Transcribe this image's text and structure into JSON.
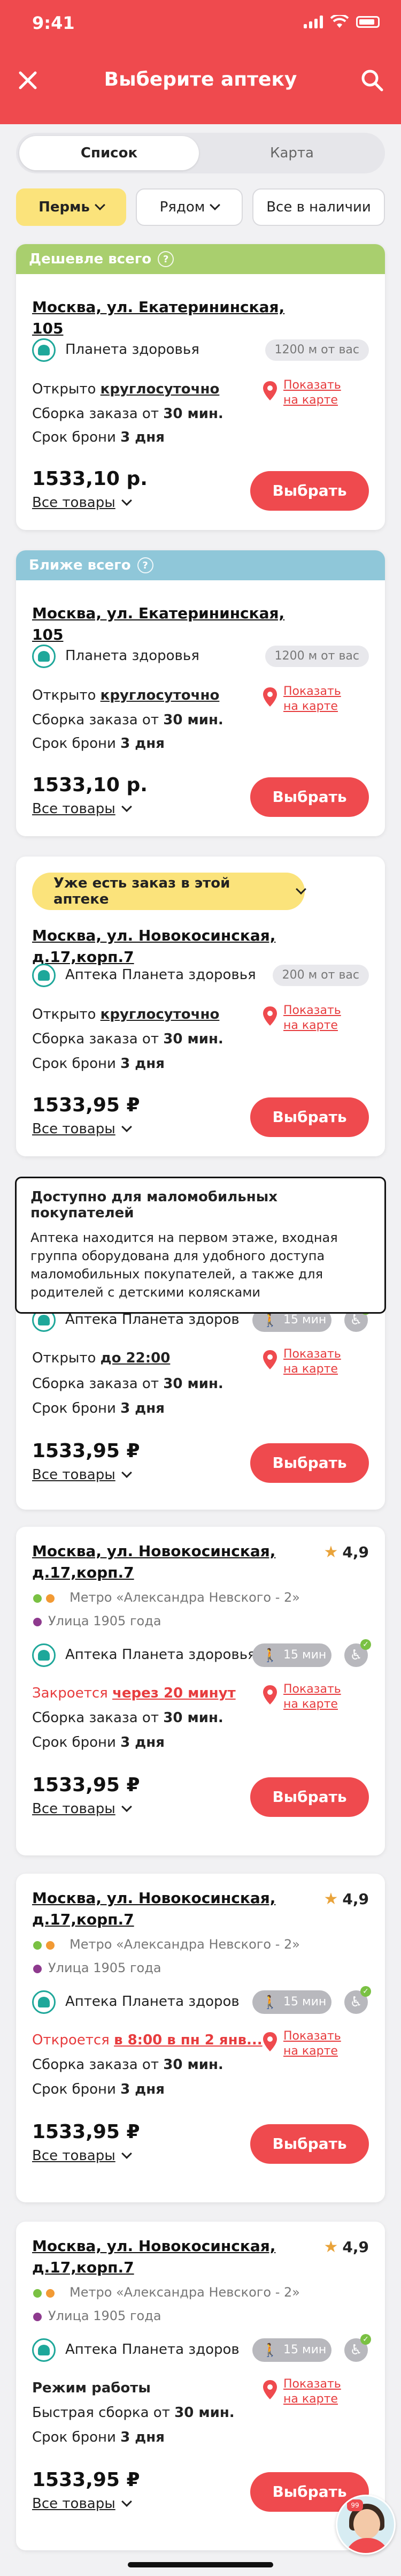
{
  "status": {
    "time": "9:41"
  },
  "header": {
    "title": "Выберите аптеку"
  },
  "tabs": {
    "list": "Список",
    "map": "Карта"
  },
  "filters": {
    "city": "Пермь",
    "near": "Рядом",
    "all": "Все в наличии"
  },
  "common": {
    "show_on_map_1": "Показать",
    "show_on_map_2": "на карте",
    "pickup_prefix": "Сборка заказа от ",
    "pickup_value": "30 мин.",
    "fast_pickup_prefix": "Быстрая сборка от ",
    "reserve_prefix": "Срок брони ",
    "reserve_value": "3 дня",
    "all_goods": "Все товары",
    "choose": "Выбрать",
    "walk_time": "15 мин",
    "metro": "Метро «Александра Невского - 2»",
    "street": "Улица 1905 года"
  },
  "cards": [
    {
      "badge": "Дешевле всего",
      "address": "Москва, ул. Екатерининская, 105",
      "pharmacy": "Планета здоровья",
      "distance": "1200 м от вас",
      "open_prefix": "Открыто ",
      "open_value": "круглосуточно",
      "price": "1533,10 р."
    },
    {
      "badge": "Ближе всего",
      "address": "Москва, ул. Екатерининская, 105",
      "pharmacy": "Планета здоровья",
      "distance": "1200 м от вас",
      "open_prefix": "Открыто ",
      "open_value": "круглосуточно",
      "price": "1533,10 р."
    },
    {
      "order_badge": "Уже есть заказ в этой аптеке",
      "address": "Москва, ул. Новокосинская, д.17,корп.7",
      "pharmacy": "Аптека Планета здоровья",
      "distance": "200 м от вас",
      "open_prefix": "Открыто ",
      "open_value": "круглосуточно",
      "price": "1533,95 ₽"
    },
    {
      "pharmacy": "Аптека Планета здоров",
      "open_prefix": "Открыто ",
      "open_value": "до 22:00",
      "price": "1533,95 ₽"
    },
    {
      "address_1": "Москва, ул. Новокосинская,",
      "address_2": "д.17,корп.7",
      "rating": "4,9",
      "pharmacy": "Аптека Планета здоровья",
      "status_prefix": "Закроется ",
      "status_value": "через 20 минут",
      "price": "1533,95 ₽"
    },
    {
      "address_1": "Москва, ул. Новокосинская,",
      "address_2": "д.17,корп.7",
      "rating": "4,9",
      "pharmacy": "Аптека Планета здоров",
      "status_prefix": "Откроется ",
      "status_value": "в 8:00 в пн 2 янв...",
      "price": "1533,95 ₽"
    },
    {
      "address_1": "Москва, ул. Новокосинская,",
      "address_2": "д.17,корп.7",
      "rating": "4,9",
      "pharmacy": "Аптека Планета здоров",
      "status_text": "Режим работы",
      "price": "1533,95 ₽"
    }
  ],
  "tooltip": {
    "title": "Доступно для маломобильных покупателей",
    "body": "Аптека находится на первом этаже, входная группа оборудована для удобного доступа маломобильных покупателей, а также для родителей с детскими колясками"
  },
  "chat_badge": "99",
  "colors": {
    "brand": "#ef4a4e",
    "green_badge": "#a9cf6e",
    "blue_badge": "#8fc7d9",
    "yellow": "#fbe37b",
    "teal": "#1ea79a"
  }
}
